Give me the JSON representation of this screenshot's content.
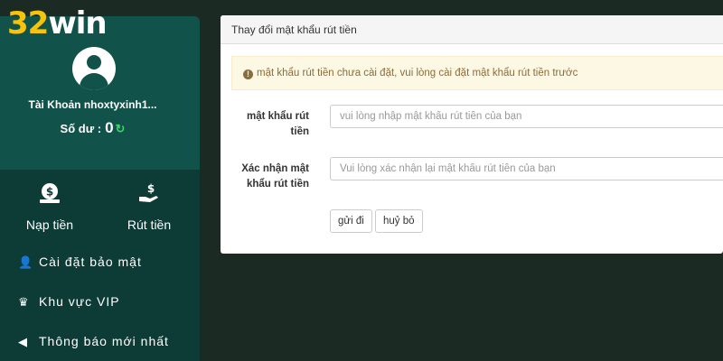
{
  "logo": {
    "number": "32",
    "word": "win"
  },
  "account": {
    "label": "Tài Khoản nhoxtyxinh1..."
  },
  "balance": {
    "label": "Số dư :",
    "amount": "0"
  },
  "quick_actions": {
    "deposit": "Nạp tiền",
    "withdraw": "Rút tiền"
  },
  "menu": {
    "security": "Cài đặt bảo mật",
    "vip": "Khu vực VIP",
    "notifications": "Thông báo mới nhất"
  },
  "panel": {
    "title": "Thay đổi mật khẩu rút tiền",
    "alert": "mật khẩu rút tiền chưa cài đặt, vui lòng cài đặt mật khẩu rút tiền trước",
    "password_label_1": "mật khẩu rút",
    "password_label_2": "tiền",
    "password_placeholder": "vui lòng nhập mật khẩu rút tiền của bạn",
    "confirm_label_1": "Xác nhận mật",
    "confirm_label_2": "khẩu rút tiền",
    "confirm_placeholder": "Vui lòng xác nhận lại mật khẩu rút tiền của bạn",
    "submit": "gửi đi",
    "cancel": "huỷ bỏ"
  },
  "colors": {
    "page_bg": "#1b2a22",
    "sidebar_bg": "#0d3b36",
    "profile_bg": "#11534a",
    "logo_accent": "#f6c40c",
    "refresh_icon": "#3fd46a",
    "alert_bg": "#fcf8e3"
  },
  "icons": {
    "avatar": "user-avatar-icon",
    "refresh": "refresh-icon",
    "deposit": "money-bag-icon",
    "withdraw": "hand-dollar-icon",
    "security": "user-lock-icon",
    "vip": "crown-icon",
    "notifications": "megaphone-icon",
    "alert": "exclamation-circle-icon"
  }
}
